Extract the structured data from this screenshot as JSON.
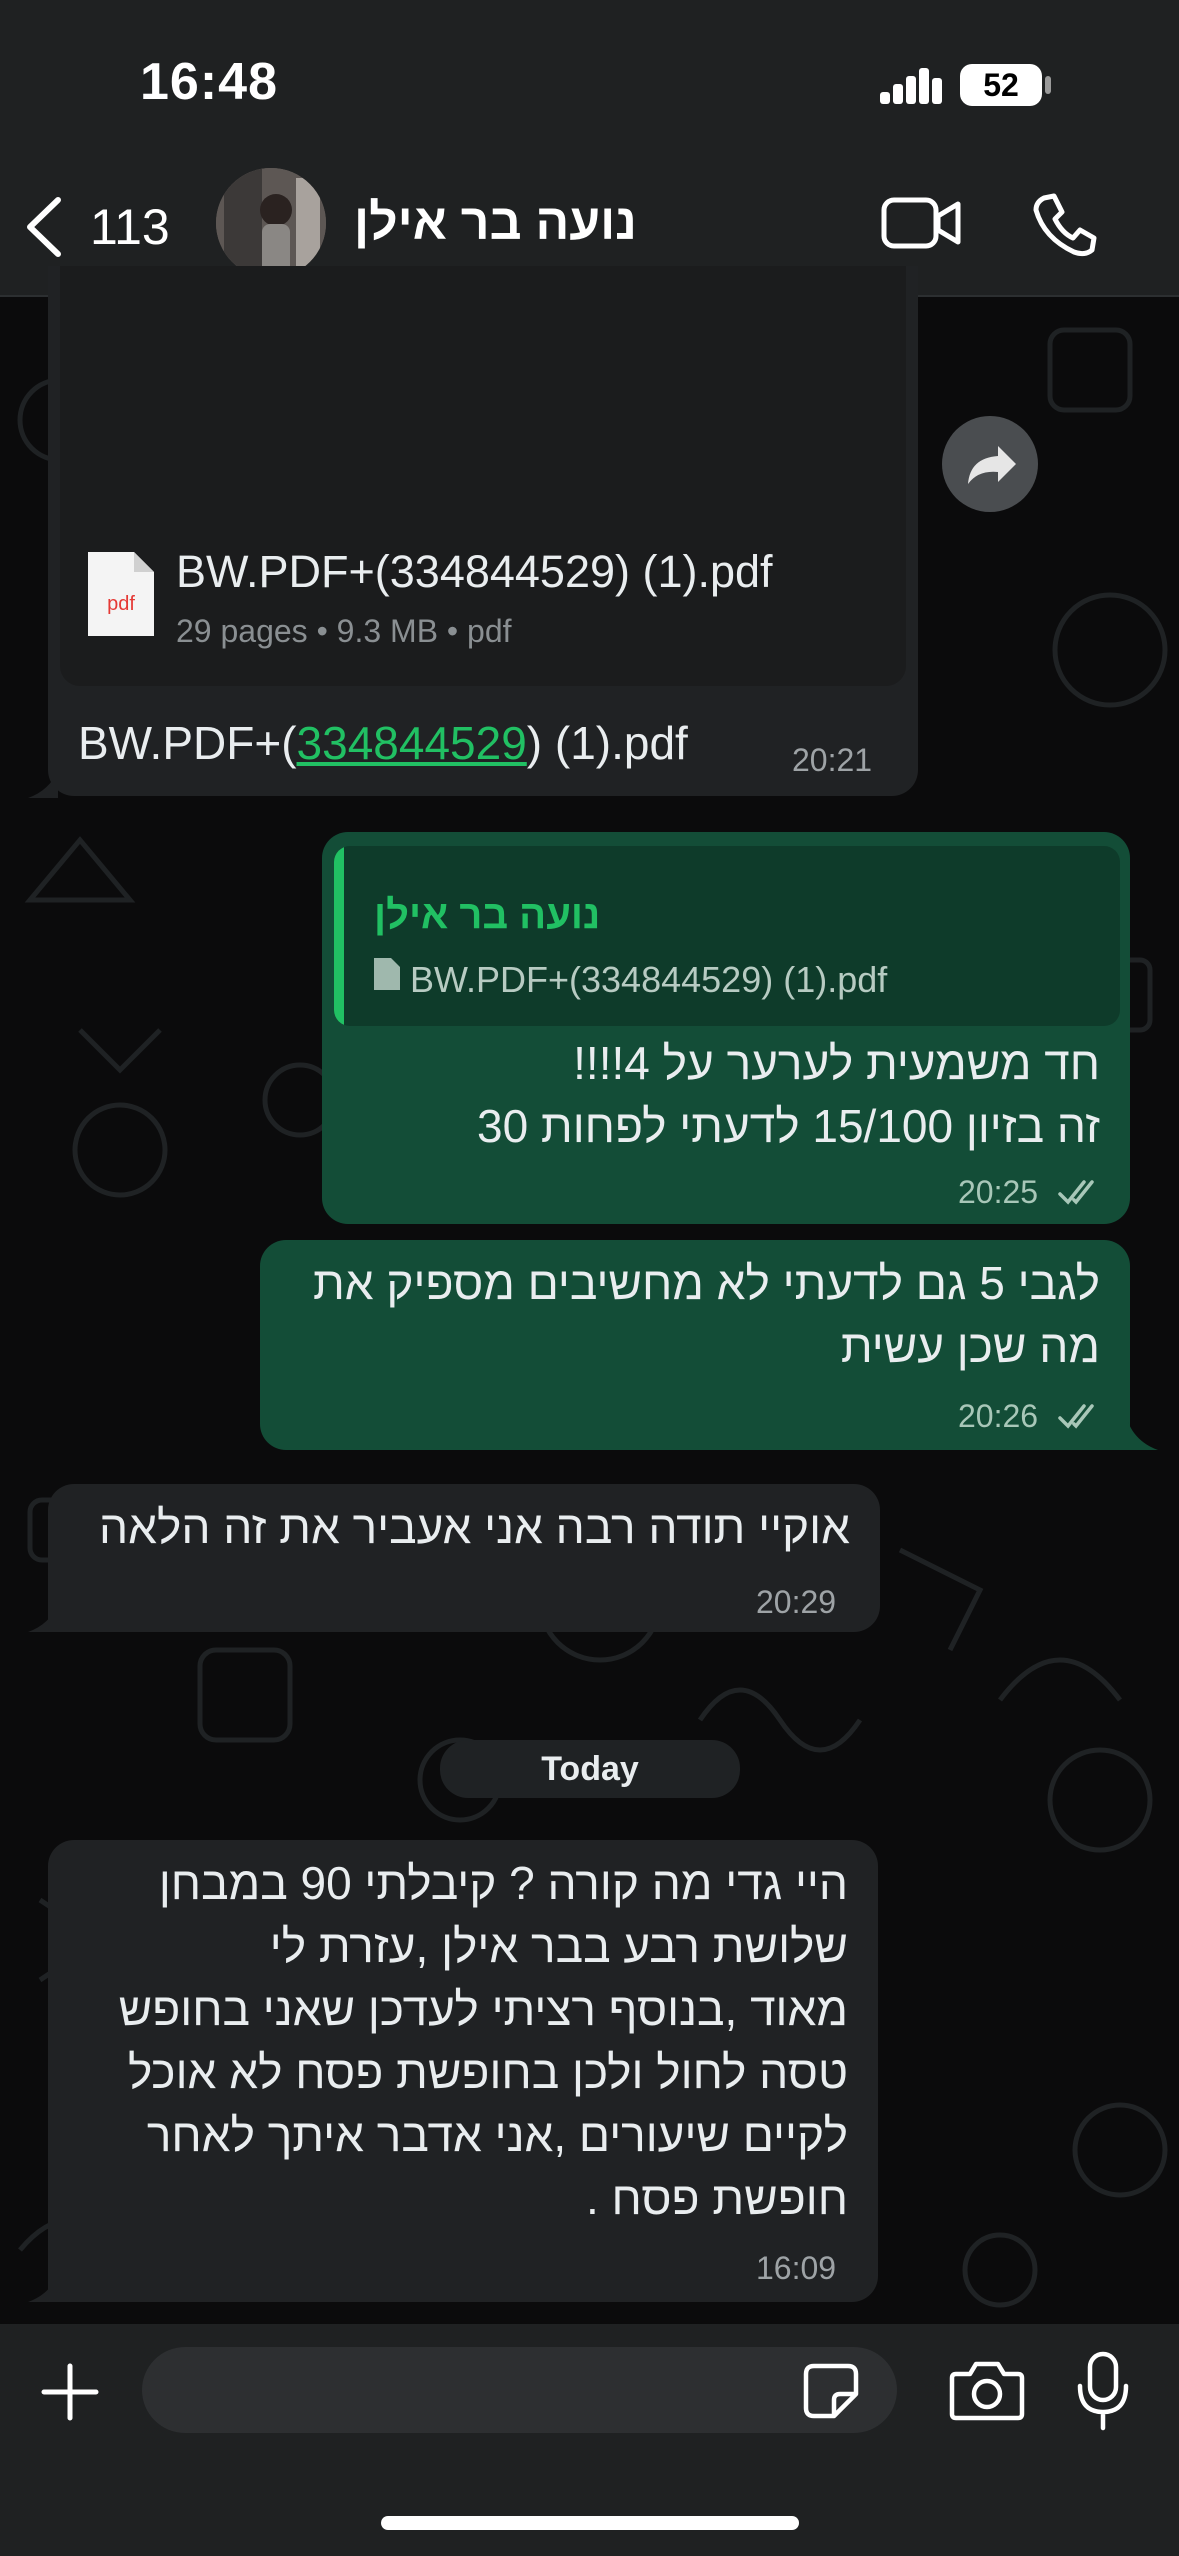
{
  "status_bar": {
    "time": "16:48",
    "battery": "52"
  },
  "header": {
    "back_count": "113",
    "contact_name": "נועה בר אילן"
  },
  "messages": {
    "document": {
      "file_name": "BW.PDF+(334844529) (1).pdf",
      "file_meta": "29 pages • 9.3 MB • pdf",
      "file_icon_label": "pdf",
      "caption_prefix": "BW.PDF+(",
      "caption_link": "334844529",
      "caption_suffix": ") (1).pdf",
      "time": "20:21"
    },
    "reply1": {
      "quoted_author": "נועה בר אילן",
      "quoted_file": "BW.PDF+(334844529) (1).pdf",
      "line1": "חד משמעית לערער על 4!!!!",
      "line2": "זה בזיון 15/100 לדעתי לפחות 30",
      "time": "20:25"
    },
    "out2": {
      "line1": "לגבי 5 גם לדעתי לא מחשיבים מספיק את",
      "line2": "מה שכן עשית",
      "time": "20:26"
    },
    "in2": {
      "text": "אוקיי תודה רבה אני אעביר את זה הלאה",
      "time": "20:29"
    },
    "date_divider": "Today",
    "in3": {
      "line1": "היי גדי מה קורה ? קיבלתי 90 במבחן",
      "line2": "שלושת רבע בבר אילן ,עזרת לי",
      "line3": "מאוד ,בנוסף רציתי לעדכן שאני בחופש",
      "line4": "טסה לחול ולכן בחופשת פסח לא אוכל",
      "line5": "לקיים שיעורים ,אני אדבר איתך לאחר",
      "line6": "חופשת פסח .",
      "time": "16:09"
    }
  },
  "colors": {
    "outgoing_bubble": "#134d37",
    "incoming_bubble": "#202224",
    "accent": "#21c063"
  },
  "icons": [
    "chevron-left-icon",
    "video-call-icon",
    "phone-icon",
    "forward-icon",
    "pdf-file-icon",
    "double-check-icon",
    "plus-icon",
    "sticker-icon",
    "camera-icon",
    "microphone-icon",
    "signal-icon",
    "battery-icon"
  ]
}
